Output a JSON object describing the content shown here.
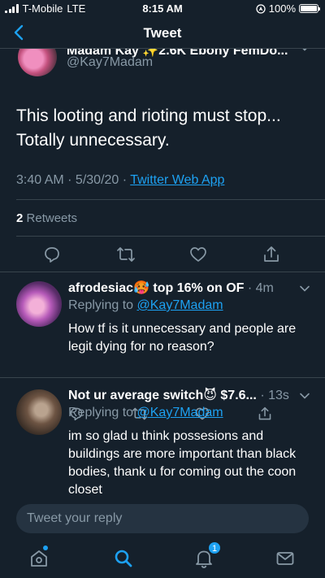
{
  "status_bar": {
    "carrier": "T-Mobile",
    "network": "LTE",
    "time": "8:15 AM",
    "battery": "100%"
  },
  "header": {
    "title": "Tweet",
    "back_icon": "chevron-left-icon"
  },
  "main_tweet": {
    "author_name": "Madam Kay ✨2.6K Ebony FemDo...",
    "handle": "@Kay7Madam",
    "text": "This looting and rioting must stop... Totally unnecessary.",
    "timestamp": "3:40 AM · 5/30/20 · ",
    "source": "Twitter Web App",
    "retweet_count": "2",
    "retweet_label": "Retweets"
  },
  "replies": [
    {
      "name": "afrodesiac🥵 top 16% on OF",
      "time": "· 4m",
      "replying_label": "Replying to",
      "replying_to": "@Kay7Madam",
      "text": "How tf is it unnecessary and people are legit dying for no reason?"
    },
    {
      "name": "Not ur average switch😈 $7.6...",
      "time": "· 13s",
      "replying_label": "Replying to",
      "replying_to": "@Kay7Madam",
      "text": "im so glad u think possesions and buildings are more important than black bodies, thank u for coming out the coon closet"
    }
  ],
  "compose": {
    "placeholder": "Tweet your reply"
  },
  "tabbar": {
    "notifications_badge": "1",
    "items": [
      "home-icon",
      "search-icon",
      "notifications-icon",
      "messages-icon"
    ]
  },
  "colors": {
    "background": "#15202b",
    "accent": "#1da1f2",
    "secondary_text": "#8899a6",
    "divider": "#38444d"
  }
}
